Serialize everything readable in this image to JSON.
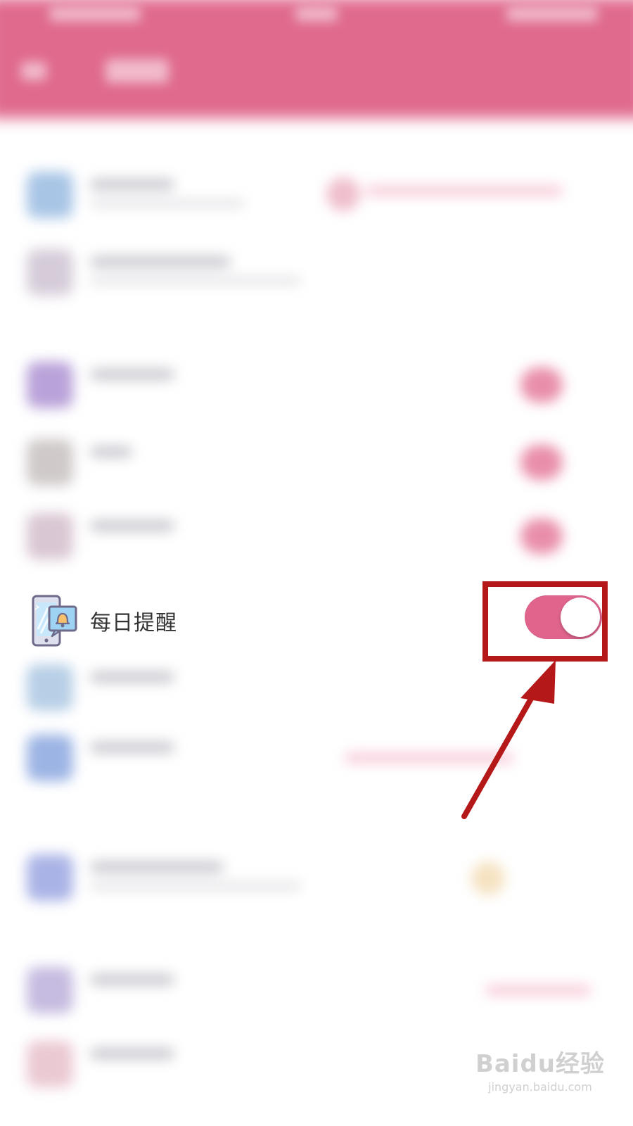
{
  "settings": {
    "daily_reminder": {
      "label": "每日提醒",
      "icon": "phone-bell-icon",
      "toggle_state": "on"
    }
  },
  "annotation": {
    "highlight_color": "#b51818",
    "arrow_color": "#b51818"
  },
  "colors": {
    "accent": "#e0648c",
    "header": "#e06a8e"
  },
  "watermark": {
    "logo": "Baidu经验",
    "url": "jingyan.baidu.com"
  }
}
